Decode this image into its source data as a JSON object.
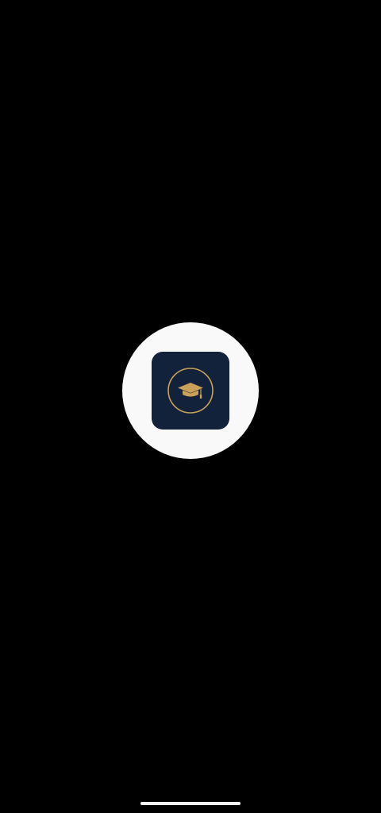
{
  "colors": {
    "background": "#000000",
    "splash_circle": "#f9f9f9",
    "app_icon_bg": "#12223a",
    "accent_gold": "#c9a15a",
    "home_indicator": "#f2f2f2"
  },
  "splash": {
    "icon": "graduation-cap-icon"
  }
}
